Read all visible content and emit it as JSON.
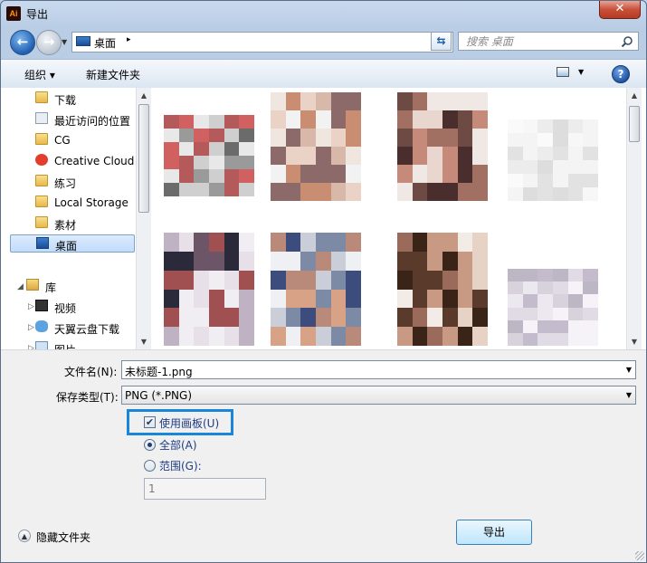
{
  "window": {
    "title": "导出",
    "app_icon_text": "Ai",
    "close": "✕"
  },
  "nav": {
    "back": "←",
    "forward": "→",
    "address": "桌面",
    "address_sep": "▸",
    "search_placeholder": "搜索 桌面"
  },
  "toolbar": {
    "organize": "组织 ▾",
    "new_folder": "新建文件夹",
    "help": "?"
  },
  "sidebar": {
    "items": [
      {
        "label": "下载",
        "icon": "folder-icon"
      },
      {
        "label": "最近访问的位置",
        "icon": "recent-places-icon"
      },
      {
        "label": "CG",
        "icon": "folder-icon"
      },
      {
        "label": "Creative Cloud",
        "icon": "creative-cloud-icon"
      },
      {
        "label": "练习",
        "icon": "folder-icon"
      },
      {
        "label": "Local Storage",
        "icon": "folder-icon"
      },
      {
        "label": "素材",
        "icon": "folder-icon"
      },
      {
        "label": "桌面",
        "icon": "desktop-icon",
        "selected": true
      },
      {
        "label": "库",
        "icon": "library-icon"
      },
      {
        "label": "视频",
        "icon": "video-icon"
      },
      {
        "label": "天翼云盘下载",
        "icon": "cloud-icon"
      },
      {
        "label": "图片",
        "icon": "pictures-icon"
      }
    ]
  },
  "form": {
    "filename_label": "文件名(N):",
    "filename_value": "未标题-1.png",
    "filetype_label": "保存类型(T):",
    "filetype_value": "PNG (*.PNG)",
    "use_artboards_label": "使用画板(U)",
    "use_artboards_checked": true,
    "all_label": "全部(A)",
    "range_label": "范围(G):",
    "range_value": "1"
  },
  "footer": {
    "hide_folders": "隐藏文件夹",
    "export_button": "导出"
  },
  "colors": {
    "highlight": "#1a86d9",
    "selection": "#c1dcfb"
  }
}
